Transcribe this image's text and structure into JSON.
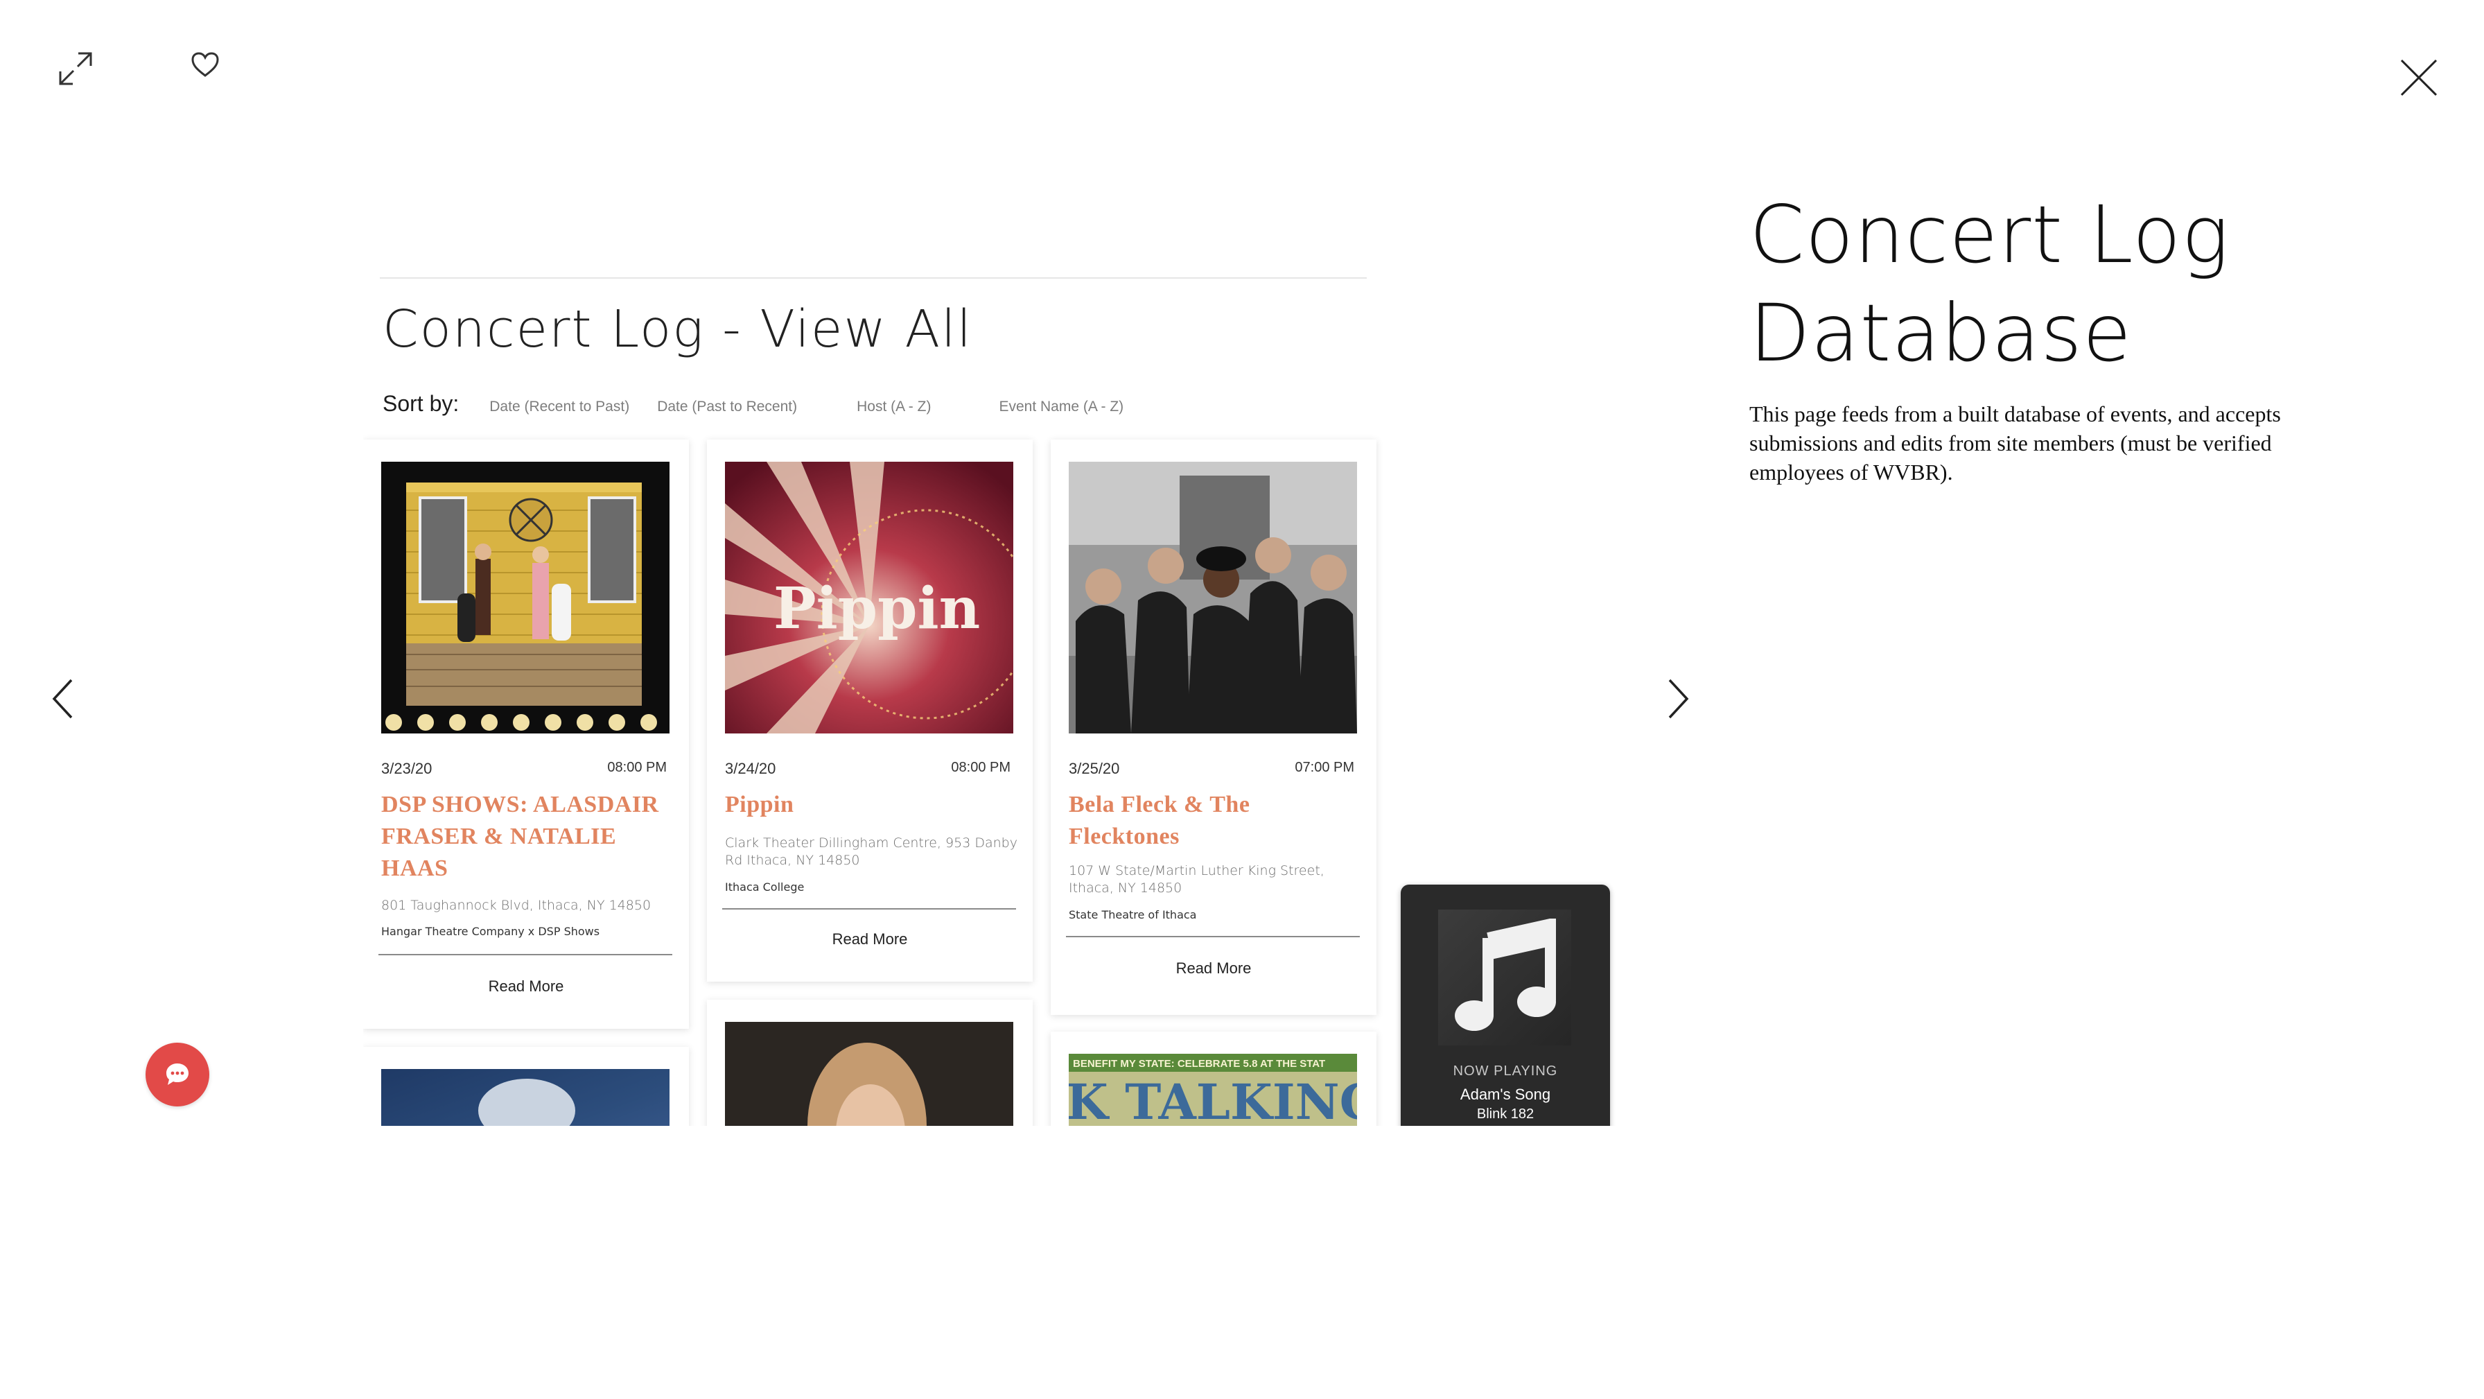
{
  "view_title": "Concert Log - View All",
  "sort": {
    "label": "Sort by:",
    "options": [
      "Date (Recent to Past)",
      "Date (Past to Recent)",
      "Host (A - Z)",
      "Event Name (A - Z)"
    ]
  },
  "events": [
    {
      "date": "3/23/20",
      "time": "08:00 PM",
      "title_lines": [
        "DSP SHOWS: ALASDAIR",
        "FRASER & NATALIE",
        "HAAS"
      ],
      "address_lines": [
        "801 Taughannock Blvd, Ithaca, NY 14850"
      ],
      "host": "Hangar Theatre Company x DSP Shows",
      "read_more": "Read More"
    },
    {
      "date": "3/24/20",
      "time": "08:00 PM",
      "title_lines": [
        "Pippin"
      ],
      "image_text": "Pippin",
      "address_lines": [
        "Clark Theater Dillingham Centre, 953 Danby",
        "Rd Ithaca, NY 14850"
      ],
      "host": "Ithaca College",
      "read_more": "Read More"
    },
    {
      "date": "3/25/20",
      "time": "07:00 PM",
      "title_lines": [
        "Bela Fleck & The",
        "Flecktones"
      ],
      "address_lines": [
        "107 W State/Martin Luther King Street,",
        "Ithaca, NY 14850"
      ],
      "host": "State Theatre of Ithaca",
      "read_more": "Read More"
    }
  ],
  "partial_banner_text": "BENEFIT MY STATE: CELEBRATE 5.8 AT THE STAT",
  "partial_banner_big": "K TALKING E",
  "now_playing": {
    "label": "NOW PLAYING",
    "song": "Adam's Song",
    "artist": "Blink 182"
  },
  "page": {
    "title": "Concert Log Database",
    "description": "This page feeds from a built database of events, and accepts submissions and edits from site members (must be verified employees of WVBR)."
  },
  "colors": {
    "event_title": "#e1845f",
    "chat_button": "#e24a48",
    "player_bg": "#2a2a2a"
  },
  "icons": [
    "expand-icon",
    "heart-icon",
    "close-icon",
    "chevron-left-icon",
    "chevron-right-icon",
    "music-note-icon",
    "chat-icon"
  ]
}
